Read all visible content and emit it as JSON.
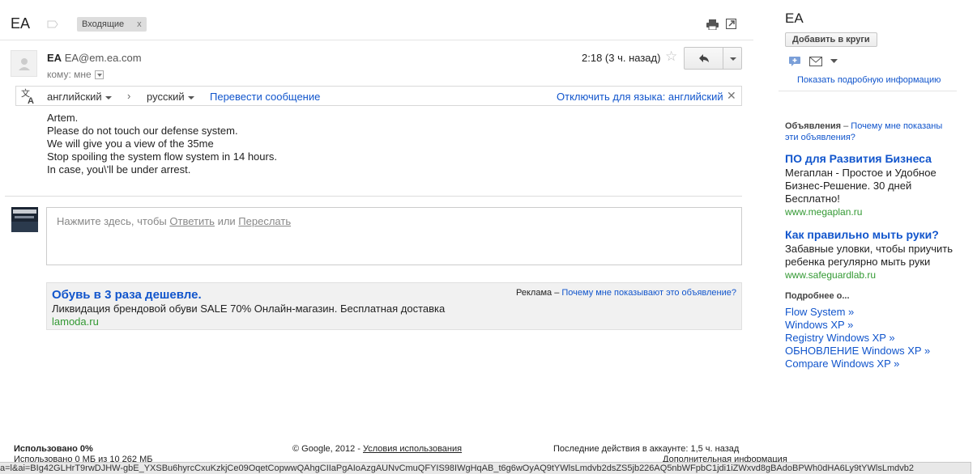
{
  "subject": "EA",
  "inbox_label": "Входящие",
  "inbox_label_close": "x",
  "message": {
    "sender_name": "EA",
    "sender_email": "EA@em.ea.com",
    "to_line": "кому: мне",
    "time": "2:18 (3 ч. назад)",
    "star": "☆",
    "body_lines": [
      "Artem.",
      "Please do not touch our defense system.",
      "We will give you a view of the 35me",
      "Stop spoiling the system flow system in 14 hours.",
      "In case, you\\'ll be under arrest."
    ]
  },
  "translate": {
    "from_lang": "английский",
    "arrow": "›",
    "to_lang": "русский",
    "translate_link": "Перевести сообщение",
    "disable_link": "Отключить для языка: английский",
    "close": "✕"
  },
  "reply_box": {
    "hint_prefix": "Нажмите здесь, чтобы ",
    "reply_link": "Ответить",
    "hint_or": " или ",
    "forward_link": "Переслать"
  },
  "inline_ad": {
    "title": "Обувь в 3 раза дешевле.",
    "text": "Ликвидация брендовой обуви SALE 70% Онлайн-магазин. Бесплатная доставка",
    "url": "lamoda.ru",
    "note_prefix": "Реклама – ",
    "note_link": "Почему мне показывают это объявление?"
  },
  "footer": {
    "used": "Использовано 0%",
    "quota": "Использовано 0 МБ из 10 262 МБ",
    "copyright": "© Google, 2012 - ",
    "terms_link": "Условия использования",
    "activity": "Последние действия в аккаунте: 1,5 ч. назад",
    "details": "Дополнительная информация"
  },
  "status_url": "a=l&ai=BIg42GLHrT9rwDJHW-gbE_YXSBu6hyrcCxuKzkjCe09OqetCopwwQAhgCIIaPgAIoAzgAUNvCmuQFYIS98IWgHqAB_t6g6wOyAQ9tYWlsLmdvb2dsZS5jb226AQ5nbWFpbC1jdi1iZWxvd8gBAdoBPWh0dHA6Ly9tYWlsLmdvb2",
  "sidebar": {
    "name": "EA",
    "add_circles": "Добавить в круги",
    "more_info": "Показать подробную информацию",
    "ads_label": "Объявления",
    "ads_dash": " – ",
    "ads_why": "Почему мне показаны эти объявления?",
    "ads": [
      {
        "title": "ПО для Развития Бизнеса",
        "desc": "Мегаплан - Простое и Удобное Бизнес-Решение. 30 дней Бесплатно!",
        "url": "www.megaplan.ru"
      },
      {
        "title": "Как правильно мыть руки?",
        "desc": "Забавные уловки, чтобы приучить ребенка регулярно мыть руки",
        "url": "www.safeguardlab.ru"
      }
    ],
    "more_header": "Подробнее о...",
    "more_links": [
      "Flow System »",
      "Windows XP »",
      "Registry Windows XP »",
      "ОБНОВЛЕНИЕ Windows XP »",
      "Compare Windows XP »"
    ]
  }
}
